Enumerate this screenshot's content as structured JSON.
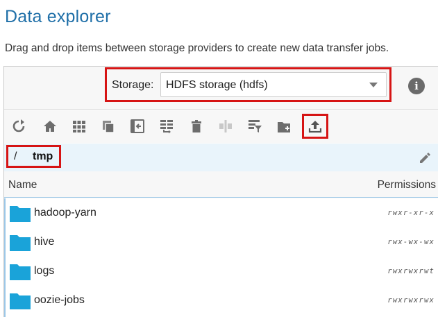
{
  "page": {
    "title": "Data explorer",
    "subtitle": "Drag and drop items between storage providers to create new data transfer jobs."
  },
  "storage": {
    "label": "Storage:",
    "selected": "HDFS storage (hdfs)",
    "info_icon": "info-icon"
  },
  "toolbar": {
    "icons": [
      "refresh-icon",
      "home-icon",
      "grid-view-icon",
      "copy-icon",
      "collapse-panel-icon",
      "transfer-icon",
      "delete-icon",
      "split-icon",
      "filter-icon",
      "new-folder-icon",
      "upload-icon"
    ]
  },
  "path": {
    "separator": "/",
    "segment": "tmp"
  },
  "list": {
    "header_name": "Name",
    "header_permissions": "Permissions",
    "items": [
      {
        "name": "hadoop-yarn",
        "permissions": "rwxr-xr-x"
      },
      {
        "name": "hive",
        "permissions": "rwx-wx-wx"
      },
      {
        "name": "logs",
        "permissions": "rwxrwxrwt"
      },
      {
        "name": "oozie-jobs",
        "permissions": "rwxrwxrwx"
      }
    ]
  },
  "colors": {
    "accent": "#1f6fa8",
    "highlight": "#d61414",
    "folder": "#1aa3d9",
    "path_bg": "#e9f4fb"
  }
}
